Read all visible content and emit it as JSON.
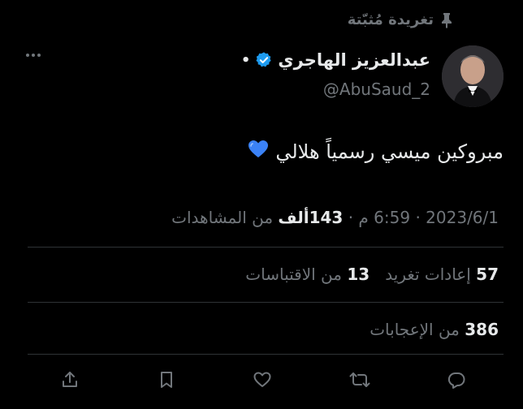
{
  "pinned": {
    "label": "تغريدة مُثبّتة",
    "icon": "pin-icon"
  },
  "author": {
    "name": "عبدالعزيز الهاجري",
    "separator": "•",
    "handle": "@AbuSaud_2",
    "verified_icon": "verified-badge-icon",
    "verified_color": "#1d9bf0"
  },
  "tweet": {
    "text": "مبروكين ميسي رسمياً هلالي",
    "emoji": "💙"
  },
  "meta": {
    "date": "2023/6/1",
    "sep1": " · ",
    "time": "6:59 م",
    "sep2": " · ",
    "views_count": "143ألف",
    "views_label": " من المشاهدات"
  },
  "stats": {
    "retweets_count": "57",
    "retweets_label": " إعادات تغريد",
    "quotes_count": "13",
    "quotes_label": " من الاقتباسات",
    "likes_count": "386",
    "likes_label": " من الإعجابات"
  },
  "actions": {
    "reply_icon": "reply-icon",
    "retweet_icon": "retweet-icon",
    "like_icon": "heart-icon",
    "bookmark_icon": "bookmark-icon",
    "share_icon": "share-icon"
  },
  "colors": {
    "background": "#000000",
    "text_primary": "#e7e9ea",
    "text_secondary": "#71767b",
    "divider": "#2f3336",
    "accent": "#1d9bf0"
  }
}
